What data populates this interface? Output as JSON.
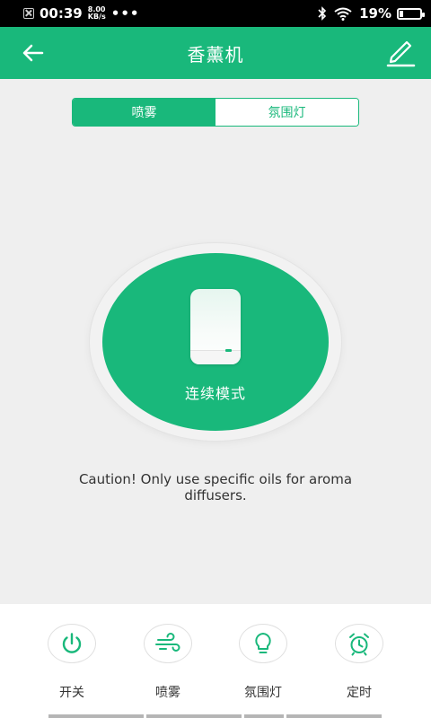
{
  "status_bar": {
    "time": "00:39",
    "speed_value": "8.00",
    "speed_unit": "KB/s",
    "dots": "•••",
    "battery": "19%",
    "battery_level": 0.19
  },
  "header": {
    "title": "香薰机",
    "back_icon": "arrow-left-icon",
    "edit_icon": "pencil-icon"
  },
  "tabs": [
    {
      "label": "喷雾",
      "active": true
    },
    {
      "label": "氛围灯",
      "active": false
    }
  ],
  "main": {
    "mode_label": "连续模式",
    "caution": "Caution! Only use specific oils for aroma diffusers."
  },
  "bottom_nav": [
    {
      "label": "开关",
      "icon": "power-icon"
    },
    {
      "label": "喷雾",
      "icon": "wind-icon"
    },
    {
      "label": "氛围灯",
      "icon": "bulb-icon"
    },
    {
      "label": "定时",
      "icon": "alarm-clock-icon"
    }
  ],
  "colors": {
    "accent": "#19b87b",
    "background": "#efefef"
  }
}
